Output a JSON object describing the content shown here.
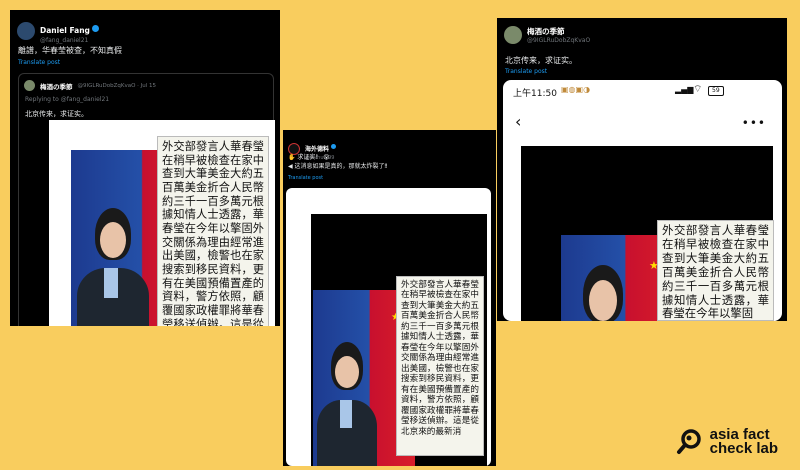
{
  "panel1": {
    "author": "Daniel Fang",
    "handle": "@fang_daniel21",
    "text": "離譜，华春莹被查，不知真假",
    "translate": "Translate post",
    "quote": {
      "author": "梅酒の季節",
      "handle": "@9IGLRuDobZqKvaO · Jul 15",
      "replying": "Replying to @fang_daniel21",
      "text": "北京传来，求证实。"
    },
    "doc_text": "外交部發言人華春瑩在稍早被檢查在家中查到大筆美金大約五百萬美金折合人民幣約三千一百多萬元根據知情人士透露，華春瑩在今年以擎固外交關係為理由經常進出美國，檢警也在家搜索到移民資料，更有在美國預備置產的資料，警方依照，顧覆國家政權罪將華春瑩移送偵辦。這是從北京來的最新消"
  },
  "panel2": {
    "author": "海外德料",
    "handle": "@zhihui999",
    "line1": "✋ 求证实！ 😮",
    "line2": "◀ 这消息如果是真的，那就太炸裂了‼",
    "translate": "Translate post",
    "doc_text": "外交部發言人華春瑩在稍早被檢查在家中查到大筆美金大約五百萬美金折合人民幣約三千一百多萬元根據知情人士透露，華春瑩在今年以擎固外交關係為理由經常進出美國，檢警也在家搜索到移民資料，更有在美國預備置產的資料，警方依照，顧覆國家政權罪將華春瑩移送偵辦。這是從北京來的最新消"
  },
  "panel3": {
    "author": "梅酒の季節",
    "handle": "@9IGLRuDobZqKvaO",
    "text": "北京传来，求证实。",
    "translate": "Translate post",
    "time": "上午11:50",
    "battery": "59",
    "doc_text": "外交部發言人華春瑩在稍早被檢查在家中查到大筆美金大約五百萬美金折合人民幣約三千一百多萬元根據知情人士透露，華春瑩在今年以擎固"
  },
  "logo": {
    "line1": "asia fact",
    "line2": "check lab"
  },
  "colors": {
    "background": "#f9cd5e",
    "link": "#1d9bf0"
  }
}
